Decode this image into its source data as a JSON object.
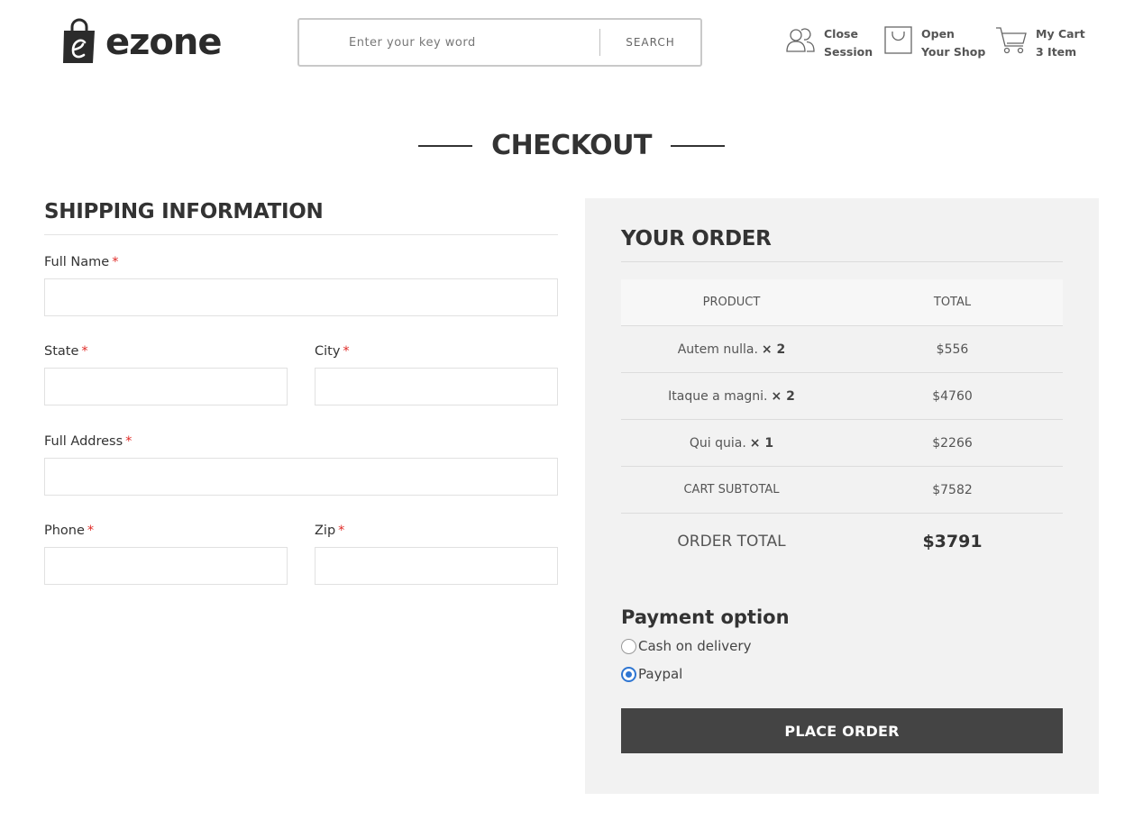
{
  "header": {
    "logo_text": "ezone",
    "logo_icon": "shopping-bag-e-icon",
    "search": {
      "placeholder": "Enter your key word",
      "button_label": "SEARCH"
    },
    "session": {
      "icon": "users-icon",
      "line1": "Close",
      "line2": "Session"
    },
    "shop": {
      "icon": "shopping-bag-icon",
      "line1": "Open",
      "line2": "Your Shop"
    },
    "cart": {
      "icon": "cart-icon",
      "line1": "My Cart",
      "line2": "3 Item"
    }
  },
  "page_title": "CHECKOUT",
  "shipping": {
    "title": "SHIPPING INFORMATION",
    "required_mark": "*",
    "fields": {
      "full_name": {
        "label": "Full Name",
        "value": ""
      },
      "state": {
        "label": "State",
        "value": ""
      },
      "city": {
        "label": "City",
        "value": ""
      },
      "full_address": {
        "label": "Full Address",
        "value": ""
      },
      "phone": {
        "label": "Phone",
        "value": ""
      },
      "zip": {
        "label": "Zip",
        "value": ""
      }
    }
  },
  "order": {
    "title": "YOUR ORDER",
    "columns": {
      "product": "PRODUCT",
      "total": "TOTAL"
    },
    "items": [
      {
        "name": "Autem nulla.",
        "qty": "× 2",
        "total": "$556"
      },
      {
        "name": "Itaque a magni.",
        "qty": "× 2",
        "total": "$4760"
      },
      {
        "name": "Qui quia.",
        "qty": "× 1",
        "total": "$2266"
      }
    ],
    "subtotal_label": "CART SUBTOTAL",
    "subtotal_value": "$7582",
    "total_label": "ORDER TOTAL",
    "total_value": "$3791"
  },
  "payment": {
    "title": "Payment option",
    "options": [
      {
        "label": "Cash on delivery",
        "checked": false
      },
      {
        "label": "Paypal",
        "checked": true
      }
    ],
    "accent_color": "#2f76d2"
  },
  "place_order_label": "PLACE ORDER"
}
